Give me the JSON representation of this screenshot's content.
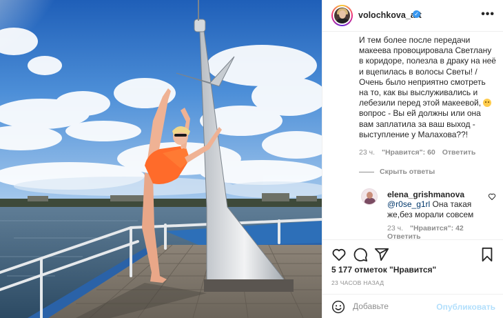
{
  "post": {
    "username": "volochkova_art",
    "verified": true,
    "more_label": "•••"
  },
  "comment": {
    "text_before_emoji": "И тем более после передачи макеева провоцировала Светлану в коридоре, полезла в драку на неё и вцепилась в волосы Светы! /Очень было неприятно смотреть на то, как вы выслуживались и лебезили перед этой макеевой, ",
    "text_after_emoji": "вопрос - Вы ей должны или она вам заплатила за ваш выход - выступление у Малахова??!",
    "age": "23 ч.",
    "likes": "\"Нравится\": 60",
    "reply_label": "Ответить"
  },
  "hide_replies_label": "Скрыть ответы",
  "reply": {
    "username": "elena_grishmanova",
    "mention": "@r0se_g1rl",
    "text": " Она такая же,без морали совсем",
    "age": "23 ч.",
    "likes": "\"Нравится\": 42",
    "reply_label": "Ответить"
  },
  "actions": {
    "likes_text": "5 177 отметок \"Нравится\"",
    "timestamp": "23 ЧАСОВ НАЗАД"
  },
  "add_comment": {
    "placeholder": "Добавьте комментарий...",
    "visible_placeholder": "Добавьте",
    "publish_label": "Опубликовать"
  },
  "colors": {
    "link": "#00376b",
    "verified": "#3897f0",
    "publish_disabled": "#b2dffc",
    "meta": "#8e8e8e"
  },
  "icons": [
    "heart-icon",
    "comment-icon",
    "share-icon",
    "bookmark-icon",
    "smile-icon",
    "verified-icon",
    "more-icon"
  ]
}
